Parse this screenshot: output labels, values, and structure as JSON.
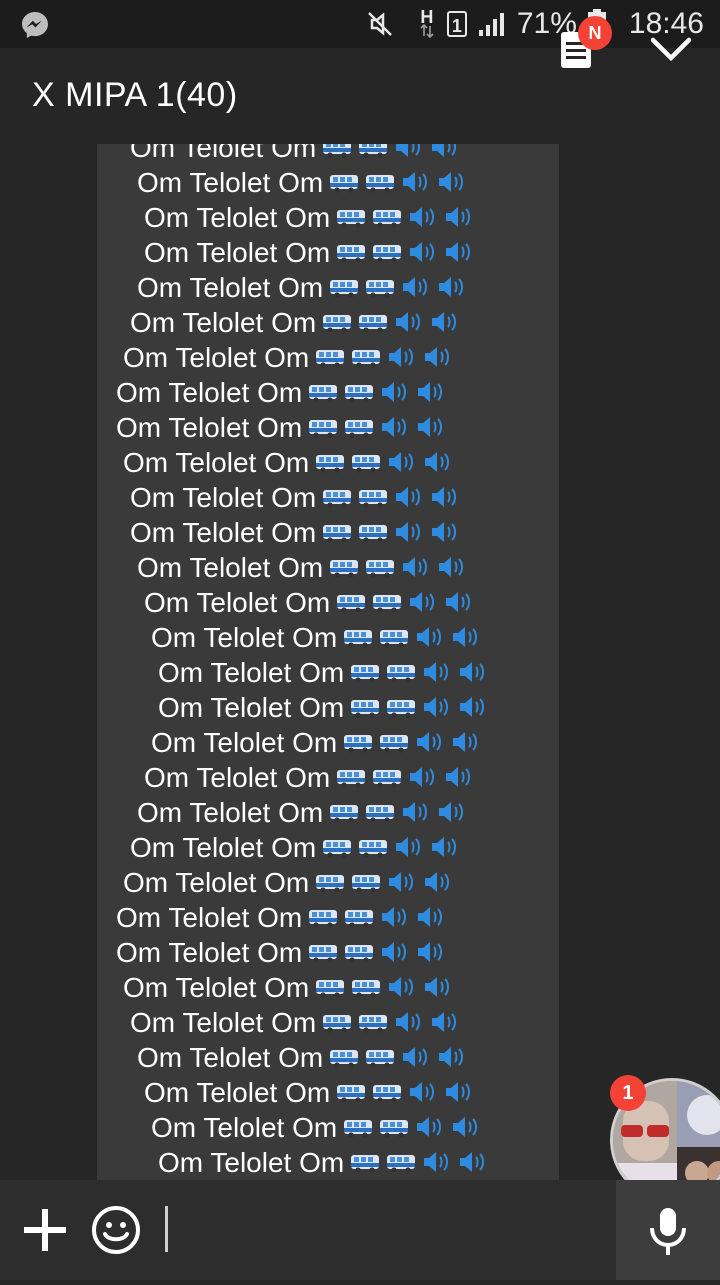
{
  "status_bar": {
    "battery_percent": "71%",
    "time": "18:46",
    "sim_slot": "1",
    "network_type": "H",
    "icons": [
      "messenger-notification-icon",
      "mute-icon",
      "data-arrows-icon",
      "signal-icon",
      "battery-icon"
    ]
  },
  "header": {
    "title": "X MIPA 1(40)",
    "notes_badge": "N"
  },
  "message": {
    "line_text": "Om Telolet Om",
    "emoji": [
      "bus-icon",
      "bus-icon",
      "speaker-icon",
      "speaker-icon"
    ],
    "lines": [
      "Om Telolet Om",
      "Om Telolet Om",
      "Om Telolet Om",
      "Om Telolet Om",
      "Om Telolet Om",
      "Om Telolet Om",
      "Om Telolet Om",
      "Om Telolet Om",
      "Om Telolet Om",
      "Om Telolet Om",
      "Om Telolet Om",
      "Om Telolet Om",
      "Om Telolet Om",
      "Om Telolet Om",
      "Om Telolet Om",
      "Om Telolet Om",
      "Om Telolet Om",
      "Om Telolet Om",
      "Om Telolet Om",
      "Om Telolet Om",
      "Om Telolet Om",
      "Om Telolet Om",
      "Om Telolet Om",
      "Om Telolet Om",
      "Om Telolet Om",
      "Om Telolet Om",
      "Om Telolet Om",
      "Om Telolet Om",
      "Om Telolet Om",
      "Om Telolet Om"
    ]
  },
  "chat_head": {
    "unread_badge": "1"
  },
  "composer": {
    "icons": [
      "add-icon",
      "emoji-icon",
      "microphone-icon"
    ]
  },
  "colors": {
    "background": "#262626",
    "bubble": "#3a3a3a",
    "badge": "#f44336",
    "text": "#ffffff"
  }
}
